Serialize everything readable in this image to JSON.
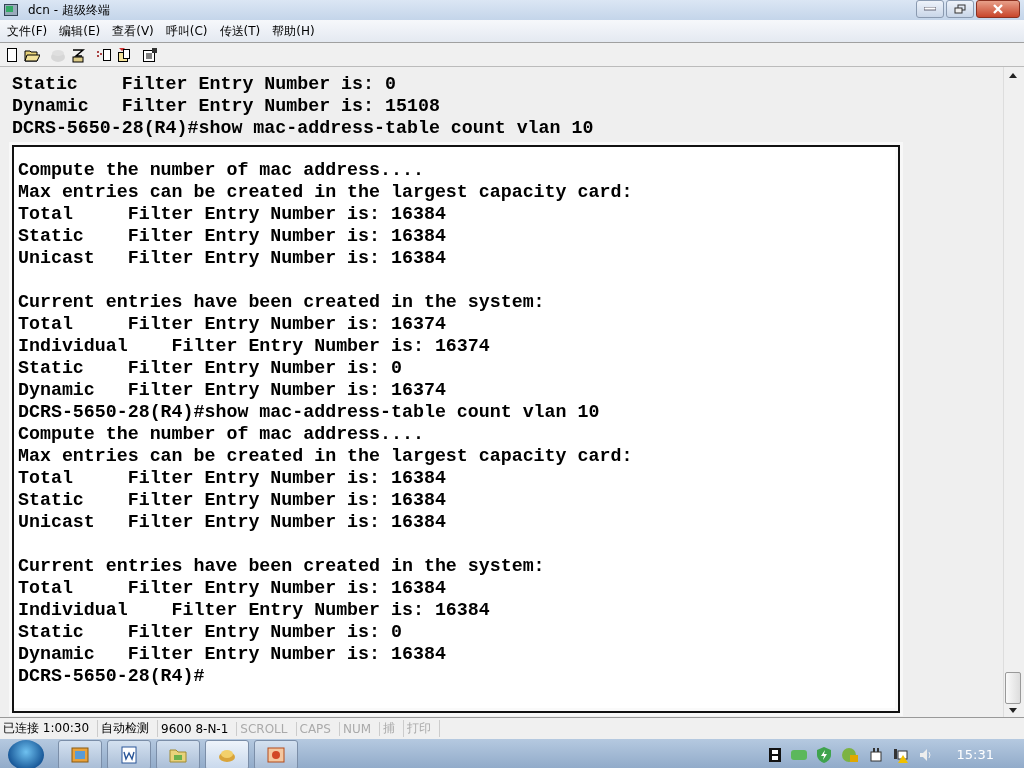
{
  "window": {
    "title": "dcn - 超级终端"
  },
  "menu": [
    "文件(F)",
    "编辑(E)",
    "查看(V)",
    "呼叫(C)",
    "传送(T)",
    "帮助(H)"
  ],
  "toolbar": [
    {
      "kind": "new",
      "disabled": false
    },
    {
      "kind": "open",
      "disabled": false
    },
    {
      "kind": "phone",
      "disabled": true
    },
    {
      "kind": "hangup",
      "disabled": false
    },
    {
      "kind": "send",
      "disabled": false
    },
    {
      "kind": "receive",
      "disabled": false
    },
    {
      "kind": "properties",
      "disabled": false
    }
  ],
  "terminal_lines": [
    "Static    Filter Entry Number is: 0",
    "Dynamic   Filter Entry Number is: 15108",
    "DCRS-5650-28(R4)#show mac-address-table count vlan 10"
  ],
  "overlay_blocks": [
    [
      "Compute the number of mac address....",
      "Max entries can be created in the largest capacity card:",
      "Total     Filter Entry Number is: 16384",
      "Static    Filter Entry Number is: 16384",
      "Unicast   Filter Entry Number is: 16384"
    ],
    [
      "Current entries have been created in the system:",
      "Total     Filter Entry Number is: 16374",
      "Individual    Filter Entry Number is: 16374",
      "Static    Filter Entry Number is: 0",
      "Dynamic   Filter Entry Number is: 16374",
      "DCRS-5650-28(R4)#show mac-address-table count vlan 10",
      "Compute the number of mac address....",
      "Max entries can be created in the largest capacity card:",
      "Total     Filter Entry Number is: 16384",
      "Static    Filter Entry Number is: 16384",
      "Unicast   Filter Entry Number is: 16384"
    ],
    [
      "Current entries have been created in the system:",
      "Total     Filter Entry Number is: 16384",
      "Individual    Filter Entry Number is: 16384",
      "Static    Filter Entry Number is: 0",
      "Dynamic   Filter Entry Number is: 16384",
      "DCRS-5650-28(R4)#"
    ]
  ],
  "status_bar": [
    {
      "text": "已连接 1:00:30",
      "active": true
    },
    {
      "text": "自动检测",
      "active": true
    },
    {
      "text": "9600 8-N-1",
      "active": true
    },
    {
      "text": "SCROLL",
      "active": false
    },
    {
      "text": "CAPS",
      "active": false
    },
    {
      "text": "NUM",
      "active": false
    },
    {
      "text": "捕",
      "active": false
    },
    {
      "text": "打印",
      "active": false
    }
  ],
  "taskbar": {
    "clock": "15:31"
  }
}
